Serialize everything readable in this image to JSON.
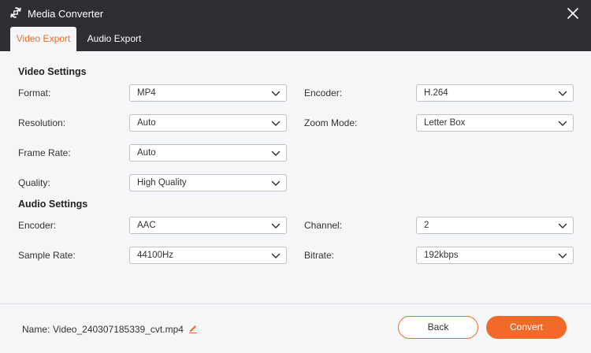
{
  "window": {
    "title": "Media Converter",
    "icon": "refresh-convert-icon",
    "close": "close-icon"
  },
  "tabs": [
    {
      "label": "Video Export",
      "active": true
    },
    {
      "label": "Audio Export",
      "active": false
    }
  ],
  "video_settings": {
    "title": "Video Settings",
    "format": {
      "label": "Format:",
      "value": "MP4"
    },
    "encoder": {
      "label": "Encoder:",
      "value": "H.264"
    },
    "resolution": {
      "label": "Resolution:",
      "value": "Auto"
    },
    "zoom_mode": {
      "label": "Zoom Mode:",
      "value": "Letter Box"
    },
    "frame_rate": {
      "label": "Frame Rate:",
      "value": "Auto"
    },
    "quality": {
      "label": "Quality:",
      "value": "High Quality"
    }
  },
  "audio_settings": {
    "title": "Audio Settings",
    "encoder": {
      "label": "Encoder:",
      "value": "AAC"
    },
    "channel": {
      "label": "Channel:",
      "value": "2"
    },
    "sample_rate": {
      "label": "Sample Rate:",
      "value": "44100Hz"
    },
    "bitrate": {
      "label": "Bitrate:",
      "value": "192kbps"
    }
  },
  "footer": {
    "name_label": "Name:",
    "name_value": "Video_240307185339_cvt.mp4",
    "back_label": "Back",
    "convert_label": "Convert"
  },
  "colors": {
    "accent": "#f26a2a",
    "titlebar": "#2e2f33",
    "background": "#f5f6f8"
  }
}
